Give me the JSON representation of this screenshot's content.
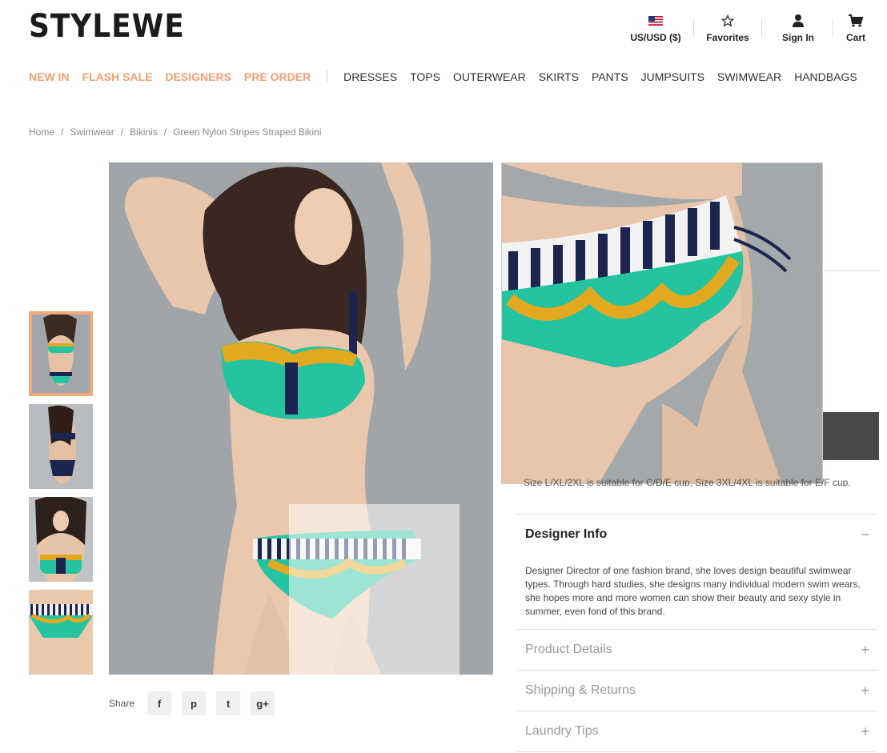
{
  "header": {
    "logo": "STYLEWE",
    "currency_label": "US/USD ($)",
    "favorites_label": "Favorites",
    "signin_label": "Sign In",
    "cart_label": "Cart"
  },
  "nav": {
    "highlights": [
      "NEW IN",
      "FLASH SALE",
      "DESIGNERS",
      "PRE ORDER"
    ],
    "categories": [
      "DRESSES",
      "TOPS",
      "OUTERWEAR",
      "SKIRTS",
      "PANTS",
      "JUMPSUITS",
      "SWIMWEAR",
      "HANDBAGS"
    ]
  },
  "breadcrumb": [
    "Home",
    "/",
    "Swimwear",
    "/",
    "Bikinis",
    "/",
    "Green Nylon Stripes Straped Bikini"
  ],
  "partial_size_text": "Size L/XL/2XL is suitable for C/D/E cup, Size 3XL/4XL is suitable for E/F cup.",
  "share": {
    "label": "Share",
    "buttons": [
      "f",
      "p",
      "t",
      "g+"
    ]
  },
  "accordions": [
    {
      "title": "Designer Info",
      "toggle": "−",
      "body": "Designer Director of one fashion brand, she loves design beautiful swimwear types. Through hard studies, she designs many individual modern swim wears, she hopes more and more women can show their beauty and sexy style in summer, even fond of this brand."
    },
    {
      "title": "Product Details",
      "toggle": "+"
    },
    {
      "title": "Shipping & Returns",
      "toggle": "+"
    },
    {
      "title": "Laundry Tips",
      "toggle": "+"
    }
  ],
  "colors": {
    "accent": "#f0a070",
    "thumb_active_border": "#f5a876",
    "bikini_green": "#25c4a0",
    "bikini_gold": "#e2a820",
    "bikini_navy": "#1c2450"
  }
}
